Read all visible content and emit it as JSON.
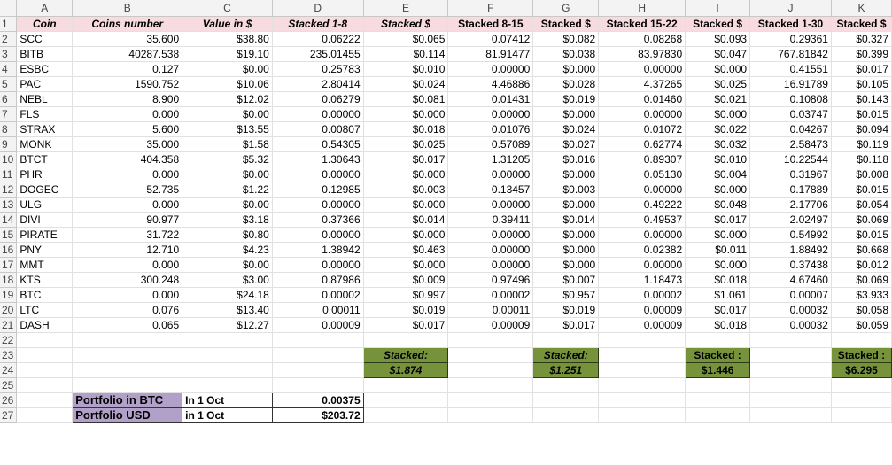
{
  "columns": [
    "A",
    "B",
    "C",
    "D",
    "E",
    "F",
    "G",
    "H",
    "I",
    "J",
    "K"
  ],
  "header": [
    "Coin",
    "Coins number",
    "Value in $",
    "Stacked 1-8",
    "Stacked $",
    "Stacked 8-15",
    "Stacked $",
    "Stacked 15-22",
    "Stacked $",
    "Stacked 1-30",
    "Stacked $"
  ],
  "rows": [
    [
      "SCC",
      "35.600",
      "$38.80",
      "0.06222",
      "$0.065",
      "0.07412",
      "$0.082",
      "0.08268",
      "$0.093",
      "0.29361",
      "$0.327"
    ],
    [
      "BITB",
      "40287.538",
      "$19.10",
      "235.01455",
      "$0.114",
      "81.91477",
      "$0.038",
      "83.97830",
      "$0.047",
      "767.81842",
      "$0.399"
    ],
    [
      "ESBC",
      "0.127",
      "$0.00",
      "0.25783",
      "$0.010",
      "0.00000",
      "$0.000",
      "0.00000",
      "$0.000",
      "0.41551",
      "$0.017"
    ],
    [
      "PAC",
      "1590.752",
      "$10.06",
      "2.80414",
      "$0.024",
      "4.46886",
      "$0.028",
      "4.37265",
      "$0.025",
      "16.91789",
      "$0.105"
    ],
    [
      "NEBL",
      "8.900",
      "$12.02",
      "0.06279",
      "$0.081",
      "0.01431",
      "$0.019",
      "0.01460",
      "$0.021",
      "0.10808",
      "$0.143"
    ],
    [
      "FLS",
      "0.000",
      "$0.00",
      "0.00000",
      "$0.000",
      "0.00000",
      "$0.000",
      "0.00000",
      "$0.000",
      "0.03747",
      "$0.015"
    ],
    [
      "STRAX",
      "5.600",
      "$13.55",
      "0.00807",
      "$0.018",
      "0.01076",
      "$0.024",
      "0.01072",
      "$0.022",
      "0.04267",
      "$0.094"
    ],
    [
      "MONK",
      "35.000",
      "$1.58",
      "0.54305",
      "$0.025",
      "0.57089",
      "$0.027",
      "0.62774",
      "$0.032",
      "2.58473",
      "$0.119"
    ],
    [
      "BTCT",
      "404.358",
      "$5.32",
      "1.30643",
      "$0.017",
      "1.31205",
      "$0.016",
      "0.89307",
      "$0.010",
      "10.22544",
      "$0.118"
    ],
    [
      "PHR",
      "0.000",
      "$0.00",
      "0.00000",
      "$0.000",
      "0.00000",
      "$0.000",
      "0.05130",
      "$0.004",
      "0.31967",
      "$0.008"
    ],
    [
      "DOGEC",
      "52.735",
      "$1.22",
      "0.12985",
      "$0.003",
      "0.13457",
      "$0.003",
      "0.00000",
      "$0.000",
      "0.17889",
      "$0.015"
    ],
    [
      "ULG",
      "0.000",
      "$0.00",
      "0.00000",
      "$0.000",
      "0.00000",
      "$0.000",
      "0.49222",
      "$0.048",
      "2.17706",
      "$0.054"
    ],
    [
      "DIVI",
      "90.977",
      "$3.18",
      "0.37366",
      "$0.014",
      "0.39411",
      "$0.014",
      "0.49537",
      "$0.017",
      "2.02497",
      "$0.069"
    ],
    [
      "PIRATE",
      "31.722",
      "$0.80",
      "0.00000",
      "$0.000",
      "0.00000",
      "$0.000",
      "0.00000",
      "$0.000",
      "0.54992",
      "$0.015"
    ],
    [
      "PNY",
      "12.710",
      "$4.23",
      "1.38942",
      "$0.463",
      "0.00000",
      "$0.000",
      "0.02382",
      "$0.011",
      "1.88492",
      "$0.668"
    ],
    [
      "MMT",
      "0.000",
      "$0.00",
      "0.00000",
      "$0.000",
      "0.00000",
      "$0.000",
      "0.00000",
      "$0.000",
      "0.37438",
      "$0.012"
    ],
    [
      "KTS",
      "300.248",
      "$3.00",
      "0.87986",
      "$0.009",
      "0.97496",
      "$0.007",
      "1.18473",
      "$0.018",
      "4.67460",
      "$0.069"
    ],
    [
      "BTC",
      "0.000",
      "$24.18",
      "0.00002",
      "$0.997",
      "0.00002",
      "$0.957",
      "0.00002",
      "$1.061",
      "0.00007",
      "$3.933"
    ],
    [
      "LTC",
      "0.076",
      "$13.40",
      "0.00011",
      "$0.019",
      "0.00011",
      "$0.019",
      "0.00009",
      "$0.017",
      "0.00032",
      "$0.058"
    ],
    [
      "DASH",
      "0.065",
      "$12.27",
      "0.00009",
      "$0.017",
      "0.00009",
      "$0.017",
      "0.00009",
      "$0.018",
      "0.00032",
      "$0.059"
    ]
  ],
  "totals": {
    "e_label": "Stacked:",
    "e_value": "$1.874",
    "g_label": "Stacked:",
    "g_value": "$1.251",
    "i_label": "Stacked :",
    "i_value": "$1.446",
    "k_label": "Stacked :",
    "k_value": "$6.295"
  },
  "portfolio": {
    "btc_label": "Portfolio in BTC",
    "btc_when": "In 1 Oct",
    "btc_value": "0.00375",
    "usd_label": "Portfolio USD",
    "usd_when": "in 1 Oct",
    "usd_value": "$203.72"
  },
  "row_numbers": [
    "1",
    "2",
    "3",
    "4",
    "5",
    "6",
    "7",
    "8",
    "9",
    "10",
    "11",
    "12",
    "13",
    "14",
    "15",
    "16",
    "17",
    "18",
    "19",
    "20",
    "21",
    "22",
    "23",
    "24",
    "25",
    "26",
    "27"
  ]
}
